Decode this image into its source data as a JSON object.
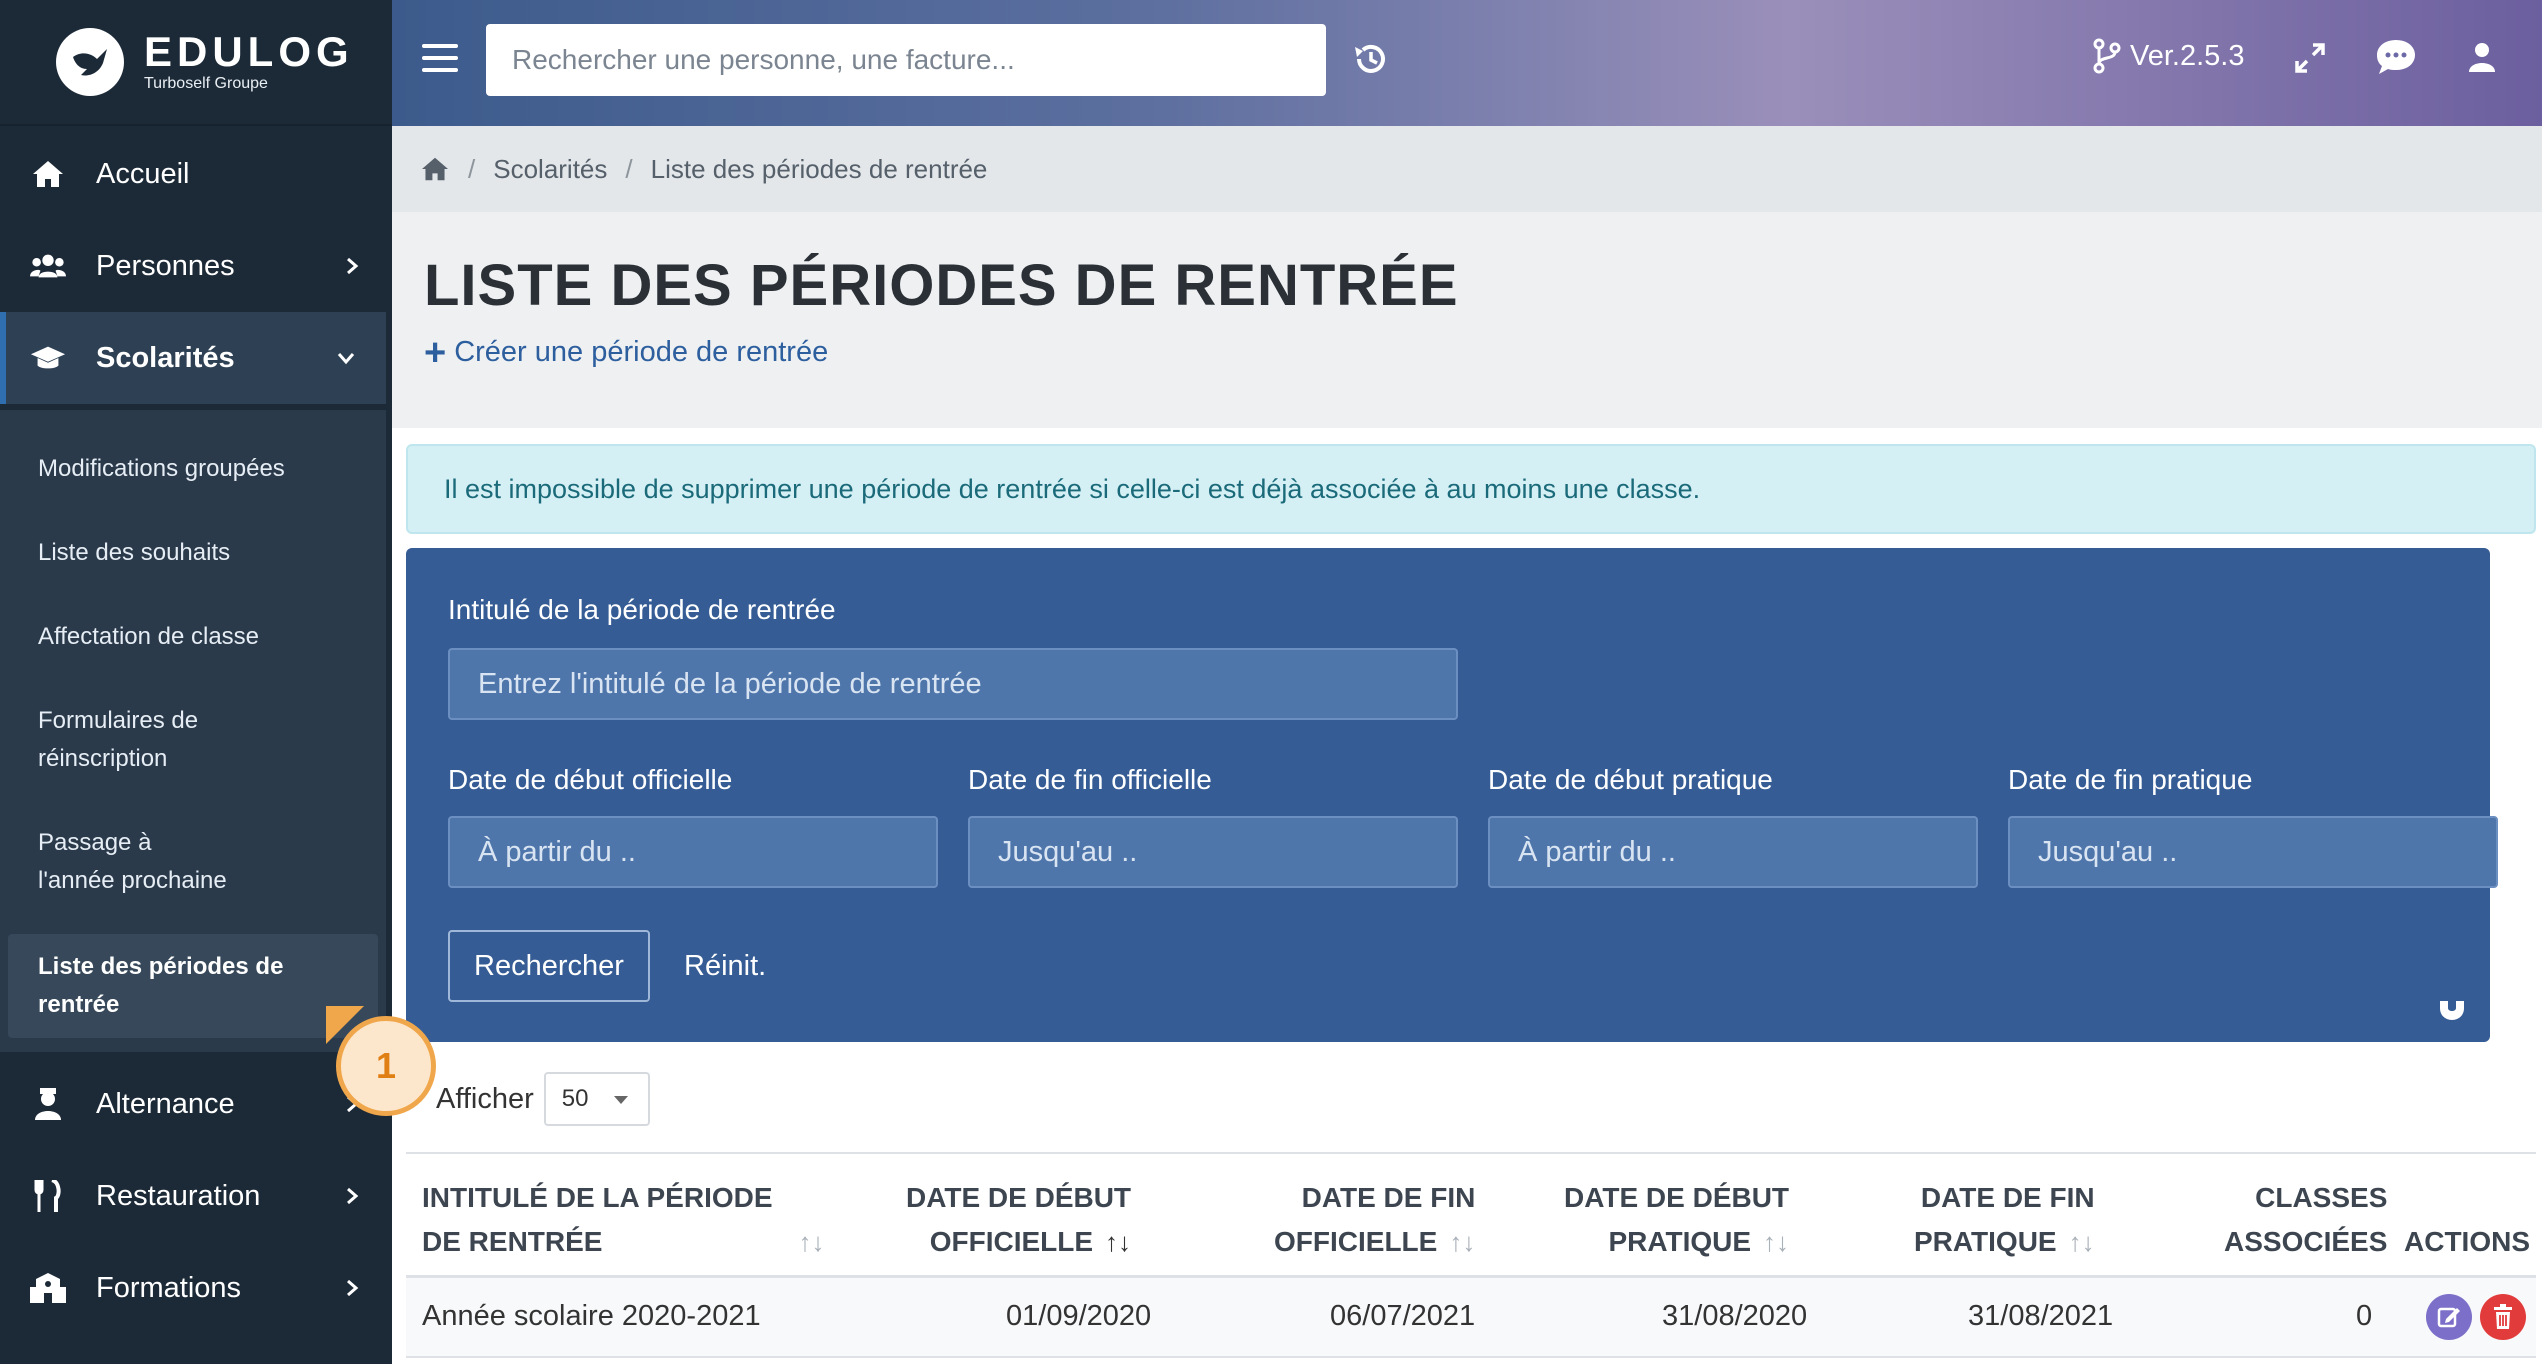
{
  "brand": {
    "name": "EDULOG",
    "subtitle": "Turboself Groupe"
  },
  "sidebar": {
    "items": [
      {
        "label": "Accueil",
        "icon": "home-icon"
      },
      {
        "label": "Personnes",
        "icon": "users-icon"
      },
      {
        "label": "Scolarités",
        "icon": "graduation-cap-icon"
      },
      {
        "label": "Alternance",
        "icon": "user-tie-icon"
      },
      {
        "label": "Restauration",
        "icon": "utensils-icon"
      },
      {
        "label": "Formations",
        "icon": "building-icon"
      }
    ],
    "submenu": [
      {
        "label": "Modifications groupées"
      },
      {
        "label": "Liste des souhaits"
      },
      {
        "label": "Affectation de classe"
      },
      {
        "label": "Formulaires de réinscription"
      },
      {
        "label": "Passage à l'année prochaine"
      },
      {
        "label": "Liste des périodes de rentrée"
      }
    ]
  },
  "topbar": {
    "search_placeholder": "Rechercher une personne, une facture...",
    "version": "Ver.2.5.3"
  },
  "breadcrumb": {
    "level1": "Scolarités",
    "level2": "Liste des périodes de rentrée"
  },
  "page": {
    "title": "LISTE DES PÉRIODES DE RENTRÉE",
    "create_label": "Créer une période de rentrée",
    "alert": "Il est impossible de supprimer une période de rentrée si celle-ci est déjà associée à au moins une classe."
  },
  "filter": {
    "title_label": "Intitulé de la période de rentrée",
    "title_placeholder": "Entrez l'intitulé de la période de rentrée",
    "start_official_label": "Date de début officielle",
    "start_official_placeholder": "À partir du ..",
    "end_official_label": "Date de fin officielle",
    "end_official_placeholder": "Jusqu'au ..",
    "start_practical_label": "Date de début pratique",
    "start_practical_placeholder": "À partir du ..",
    "end_practical_label": "Date de fin pratique",
    "end_practical_placeholder": "Jusqu'au ..",
    "search_button": "Rechercher",
    "reset_button": "Réinit."
  },
  "list": {
    "show_label": "Afficher",
    "page_size": "50",
    "columns": {
      "title_l1": "INTITULÉ DE LA PÉRIODE",
      "title_l2": "DE RENTRÉE",
      "start_official_l1": "DATE DE DÉBUT",
      "start_official_l2": "OFFICIELLE",
      "end_official_l1": "DATE DE FIN",
      "end_official_l2": "OFFICIELLE",
      "start_practical_l1": "DATE DE DÉBUT",
      "start_practical_l2": "PRATIQUE",
      "end_practical_l1": "DATE DE FIN",
      "end_practical_l2": "PRATIQUE",
      "classes_l1": "CLASSES",
      "classes_l2": "ASSOCIÉES",
      "actions": "ACTIONS"
    },
    "rows": [
      {
        "title": "Année scolaire 2020-2021",
        "start_official": "01/09/2020",
        "end_official": "06/07/2021",
        "start_practical": "31/08/2020",
        "end_practical": "31/08/2021",
        "classes": "0"
      }
    ]
  },
  "callout": {
    "number": "1"
  },
  "colors": {
    "sidebar_bg": "#1c2a38",
    "filter_bg": "#355c94",
    "accent": "#2d5e9e",
    "alert_bg": "#d4f0f5",
    "edit": "#7b6fc9",
    "delete": "#e23b3b",
    "callout": "#f0a74c"
  }
}
